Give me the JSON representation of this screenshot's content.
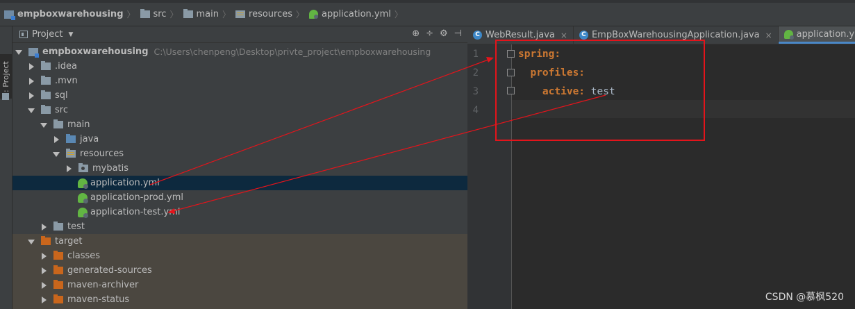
{
  "breadcrumb": {
    "items": [
      {
        "label": "empboxwarehousing",
        "icon": "module-icon"
      },
      {
        "label": "src",
        "icon": "folder-icon"
      },
      {
        "label": "main",
        "icon": "folder-icon"
      },
      {
        "label": "resources",
        "icon": "resources-folder-icon"
      },
      {
        "label": "application.yml",
        "icon": "spring-config-icon"
      }
    ]
  },
  "sidestrip": {
    "tab_label": "1: Project"
  },
  "project_panel": {
    "title": "Project",
    "tools": [
      "⊕",
      "÷",
      "⚙",
      "⊣"
    ],
    "root": {
      "label": "empboxwarehousing",
      "path": "C:\\Users\\chenpeng\\Desktop\\privte_project\\empboxwarehousing"
    },
    "items": [
      {
        "label": ".idea"
      },
      {
        "label": ".mvn"
      },
      {
        "label": "sql"
      },
      {
        "label": "src"
      },
      {
        "label": "main"
      },
      {
        "label": "java"
      },
      {
        "label": "resources"
      },
      {
        "label": "mybatis"
      },
      {
        "label": "application.yml"
      },
      {
        "label": "application-prod.yml"
      },
      {
        "label": "application-test.yml"
      },
      {
        "label": "test"
      },
      {
        "label": "target"
      },
      {
        "label": "classes"
      },
      {
        "label": "generated-sources"
      },
      {
        "label": "maven-archiver"
      },
      {
        "label": "maven-status"
      }
    ]
  },
  "editor_tabs": [
    {
      "label": "WebResult.java",
      "icon": "class-icon",
      "active": false
    },
    {
      "label": "EmpBoxWarehousingApplication.java",
      "icon": "spring-class-icon",
      "active": false
    },
    {
      "label": "application.yml",
      "icon": "spring-config-icon",
      "active": true
    }
  ],
  "editor": {
    "line_numbers": [
      "1",
      "2",
      "3",
      "4"
    ],
    "lines": [
      {
        "key": "spring:",
        "value": ""
      },
      {
        "key": "profiles:",
        "value": ""
      },
      {
        "key": "active:",
        "value": " test"
      }
    ]
  },
  "colors": {
    "annotation": "#e4141b",
    "keyword": "#cc7832",
    "selection": "#0d293e"
  },
  "watermark": "CSDN @慕枫520"
}
